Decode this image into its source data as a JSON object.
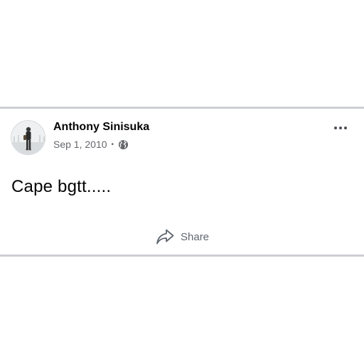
{
  "post": {
    "author": "Anthony Sinisuka",
    "date": "Sep 1, 2010",
    "separator": "•",
    "privacy_icon": "globe-icon",
    "text": "Cape bgtt.....",
    "more_icon": "more-options-icon",
    "share_label": "Share",
    "share_icon": "share-arrow-icon"
  },
  "colors": {
    "divider": "#ccced3",
    "author_text": "#050505",
    "meta_text": "#65676b",
    "share_text": "#606770"
  }
}
